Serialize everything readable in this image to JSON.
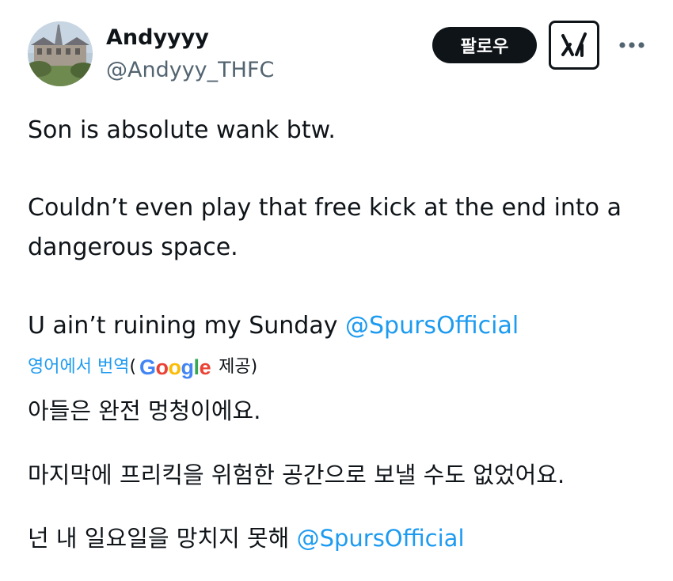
{
  "author": {
    "display_name": "Andyyyy",
    "handle": "@Andyyy_THFC"
  },
  "header": {
    "follow_label": "팔로우",
    "grok_icon": "grok-x-icon",
    "more_icon": "more-dots-icon"
  },
  "tweet": {
    "line1": "Son is absolute wank btw.",
    "line2": "Couldn’t even play that free kick at the end into a",
    "line3": "dangerous space.",
    "line4_text": "U ain’t ruining my Sunday ",
    "line4_mention": "@SpursOfficial"
  },
  "translation": {
    "link_label": "영어에서 번역",
    "open_paren": "(",
    "provider_logo": "Google",
    "provider_suffix": "제공)",
    "line1": "아들은 완전 멍청이에요.",
    "line2": "마지막에 프리킥을 위험한 공간으로 보낼 수도 없었어요.",
    "line3_text": "넌 내 일요일을 망치지 못해 ",
    "line3_mention": "@SpursOfficial"
  },
  "colors": {
    "text": "#0f1419",
    "secondary": "#536471",
    "link": "#1d9bf0",
    "button_bg": "#0f1419"
  }
}
